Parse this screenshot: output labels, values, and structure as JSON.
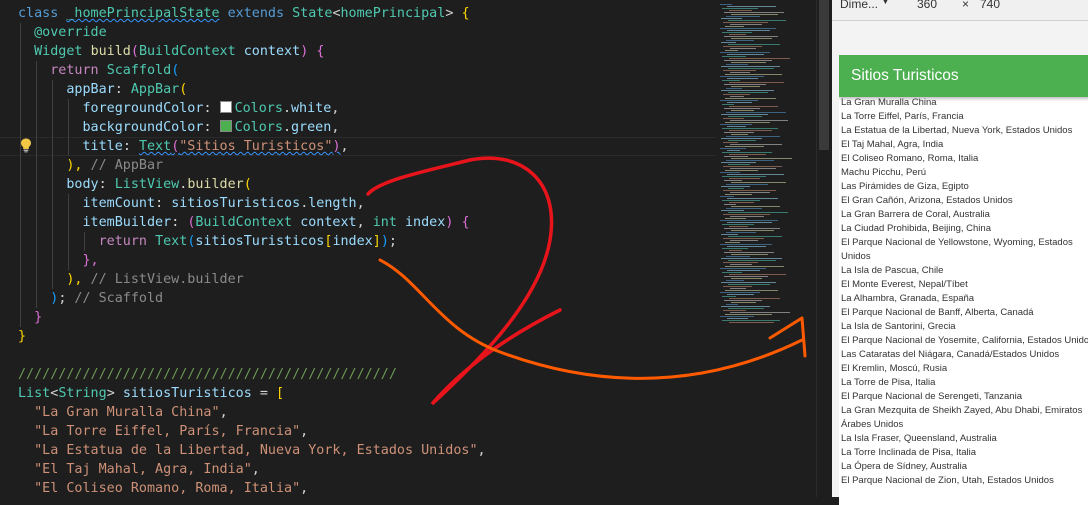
{
  "editor": {
    "lines": [
      [
        [
          "tok-kw",
          "class "
        ],
        [
          "tok-cls squiggle",
          "_homePrincipalState"
        ],
        [
          "tok-kw",
          " extends "
        ],
        [
          "tok-cls",
          "State"
        ],
        [
          "tok-plain",
          "<"
        ],
        [
          "tok-cls",
          "homePrincipal"
        ],
        [
          "tok-plain",
          "> "
        ],
        [
          "tok-p1",
          "{"
        ]
      ],
      [
        [
          "tok-plain",
          "  "
        ],
        [
          "tok-cls",
          "@override"
        ]
      ],
      [
        [
          "tok-plain",
          "  "
        ],
        [
          "tok-cls",
          "Widget"
        ],
        [
          "tok-plain",
          " "
        ],
        [
          "tok-fn",
          "build"
        ],
        [
          "tok-p2",
          "("
        ],
        [
          "tok-cls",
          "BuildContext"
        ],
        [
          "tok-plain",
          " "
        ],
        [
          "tok-var",
          "context"
        ],
        [
          "tok-p2",
          ")"
        ],
        [
          "tok-plain",
          " "
        ],
        [
          "tok-p2",
          "{"
        ]
      ],
      [
        [
          "tok-plain",
          "    "
        ],
        [
          "tok-kw2",
          "return"
        ],
        [
          "tok-plain",
          " "
        ],
        [
          "tok-cls",
          "Scaffold"
        ],
        [
          "tok-p3",
          "("
        ]
      ],
      [
        [
          "tok-plain",
          "      "
        ],
        [
          "tok-var",
          "appBar"
        ],
        [
          "tok-plain",
          ": "
        ],
        [
          "tok-cls",
          "AppBar"
        ],
        [
          "tok-p1",
          "("
        ]
      ],
      [
        [
          "tok-plain",
          "        "
        ],
        [
          "tok-var",
          "foregroundColor"
        ],
        [
          "tok-plain",
          ": "
        ],
        [
          "swatch",
          "#ffffff"
        ],
        [
          "tok-cls",
          "Colors"
        ],
        [
          "tok-plain",
          "."
        ],
        [
          "tok-var",
          "white"
        ],
        [
          "tok-plain",
          ","
        ]
      ],
      [
        [
          "tok-plain",
          "        "
        ],
        [
          "tok-var",
          "backgroundColor"
        ],
        [
          "tok-plain",
          ": "
        ],
        [
          "swatch",
          "#4caf50"
        ],
        [
          "tok-cls",
          "Colors"
        ],
        [
          "tok-plain",
          "."
        ],
        [
          "tok-var",
          "green"
        ],
        [
          "tok-plain",
          ","
        ]
      ],
      [
        [
          "tok-plain",
          "        "
        ],
        [
          "tok-var",
          "title"
        ],
        [
          "tok-plain",
          ": "
        ],
        [
          "tok-cls squiggle",
          "Text"
        ],
        [
          "tok-p2 squiggle",
          "("
        ],
        [
          "tok-str squiggle",
          "\"Sitios Turisticos\""
        ],
        [
          "tok-p2 squiggle",
          ")"
        ],
        [
          "tok-plain",
          ","
        ]
      ],
      [
        [
          "tok-plain",
          "      "
        ],
        [
          "tok-p1",
          "),"
        ],
        [
          "tok-cmt",
          " // AppBar"
        ]
      ],
      [
        [
          "tok-plain",
          "      "
        ],
        [
          "tok-var",
          "body"
        ],
        [
          "tok-plain",
          ": "
        ],
        [
          "tok-cls",
          "ListView"
        ],
        [
          "tok-plain",
          "."
        ],
        [
          "tok-fn",
          "builder"
        ],
        [
          "tok-p1",
          "("
        ]
      ],
      [
        [
          "tok-plain",
          "        "
        ],
        [
          "tok-var",
          "itemCount"
        ],
        [
          "tok-plain",
          ": "
        ],
        [
          "tok-var",
          "sitiosTuristicos"
        ],
        [
          "tok-plain",
          "."
        ],
        [
          "tok-var",
          "length"
        ],
        [
          "tok-plain",
          ","
        ]
      ],
      [
        [
          "tok-plain",
          "        "
        ],
        [
          "tok-var",
          "itemBuilder"
        ],
        [
          "tok-plain",
          ": "
        ],
        [
          "tok-p2",
          "("
        ],
        [
          "tok-cls",
          "BuildContext"
        ],
        [
          "tok-plain",
          " "
        ],
        [
          "tok-var",
          "context"
        ],
        [
          "tok-plain",
          ", "
        ],
        [
          "tok-cls",
          "int"
        ],
        [
          "tok-plain",
          " "
        ],
        [
          "tok-var",
          "index"
        ],
        [
          "tok-p2",
          ")"
        ],
        [
          "tok-plain",
          " "
        ],
        [
          "tok-p2",
          "{"
        ]
      ],
      [
        [
          "tok-plain",
          "          "
        ],
        [
          "tok-kw2",
          "return"
        ],
        [
          "tok-plain",
          " "
        ],
        [
          "tok-cls",
          "Text"
        ],
        [
          "tok-p3",
          "("
        ],
        [
          "tok-var",
          "sitiosTuristicos"
        ],
        [
          "tok-p1",
          "["
        ],
        [
          "tok-var",
          "index"
        ],
        [
          "tok-p1",
          "]"
        ],
        [
          "tok-p3",
          ")"
        ],
        [
          "tok-plain",
          ";"
        ]
      ],
      [
        [
          "tok-plain",
          "        "
        ],
        [
          "tok-p2",
          "},"
        ]
      ],
      [
        [
          "tok-plain",
          "      "
        ],
        [
          "tok-p1",
          "),"
        ],
        [
          "tok-cmt",
          " // ListView.builder"
        ]
      ],
      [
        [
          "tok-plain",
          "    "
        ],
        [
          "tok-p3",
          ")"
        ],
        [
          "tok-plain",
          ";"
        ],
        [
          "tok-cmt",
          " // Scaffold"
        ]
      ],
      [
        [
          "tok-plain",
          "  "
        ],
        [
          "tok-p2",
          "}"
        ]
      ],
      [
        [
          "tok-p1",
          "}"
        ]
      ],
      [
        [
          "tok-plain",
          ""
        ]
      ],
      [
        [
          "tok-cmt2",
          "///////////////////////////////////////////////"
        ]
      ],
      [
        [
          "tok-cls",
          "List"
        ],
        [
          "tok-plain",
          "<"
        ],
        [
          "tok-cls",
          "String"
        ],
        [
          "tok-plain",
          "> "
        ],
        [
          "tok-var",
          "sitiosTuristicos"
        ],
        [
          "tok-plain",
          " = "
        ],
        [
          "tok-p1",
          "["
        ]
      ],
      [
        [
          "tok-plain",
          "  "
        ],
        [
          "tok-str",
          "\"La Gran Muralla China\""
        ],
        [
          "tok-plain",
          ","
        ]
      ],
      [
        [
          "tok-plain",
          "  "
        ],
        [
          "tok-str",
          "\"La Torre Eiffel, París, Francia\""
        ],
        [
          "tok-plain",
          ","
        ]
      ],
      [
        [
          "tok-plain",
          "  "
        ],
        [
          "tok-str",
          "\"La Estatua de la Libertad, Nueva York, Estados Unidos\""
        ],
        [
          "tok-plain",
          ","
        ]
      ],
      [
        [
          "tok-plain",
          "  "
        ],
        [
          "tok-str",
          "\"El Taj Mahal, Agra, India\""
        ],
        [
          "tok-plain",
          ","
        ]
      ],
      [
        [
          "tok-plain",
          "  "
        ],
        [
          "tok-str",
          "\"El Coliseo Romano, Roma, Italia\""
        ],
        [
          "tok-plain",
          ","
        ]
      ]
    ]
  },
  "devtools": {
    "dimensions_label": "Dime...",
    "dropdown_icon": "chevron-down-icon",
    "width_value": "360",
    "times_sign": "×",
    "height_value": "740"
  },
  "app": {
    "appbar_title": "Sitios Turisticos",
    "appbar_color": "#4caf50",
    "sites": [
      "La Gran Muralla China",
      "La Torre Eiffel, París, Francia",
      "La Estatua de la Libertad, Nueva York, Estados Unidos",
      "El Taj Mahal, Agra, India",
      "El Coliseo Romano, Roma, Italia",
      "Machu Picchu, Perú",
      "Las Pirámides de Giza, Egipto",
      "El Gran Cañón, Arizona, Estados Unidos",
      "La Gran Barrera de Coral, Australia",
      "La Ciudad Prohibida, Beijing, China",
      "El Parque Nacional de Yellowstone, Wyoming, Estados Unidos",
      "La Isla de Pascua, Chile",
      "El Monte Everest, Nepal/Tíbet",
      "La Alhambra, Granada, España",
      "El Parque Nacional de Banff, Alberta, Canadá",
      "La Isla de Santorini, Grecia",
      "El Parque Nacional de Yosemite, California, Estados Unidos",
      "Las Cataratas del Niágara, Canadá/Estados Unidos",
      "El Kremlin, Moscú, Rusia",
      "La Torre de Pisa, Italia",
      "El Parque Nacional de Serengeti, Tanzania",
      "La Gran Mezquita de Sheikh Zayed, Abu Dhabi, Emiratos Árabes Unidos",
      "La Isla Fraser, Queensland, Australia",
      "La Torre Inclinada de Pisa, Italia",
      "La Ópera de Sídney, Australia",
      "El Parque Nacional de Zion, Utah, Estados Unidos"
    ]
  },
  "annotations": {
    "arrow_color": "#ff5a00",
    "scribble_color": "#e8141c"
  }
}
